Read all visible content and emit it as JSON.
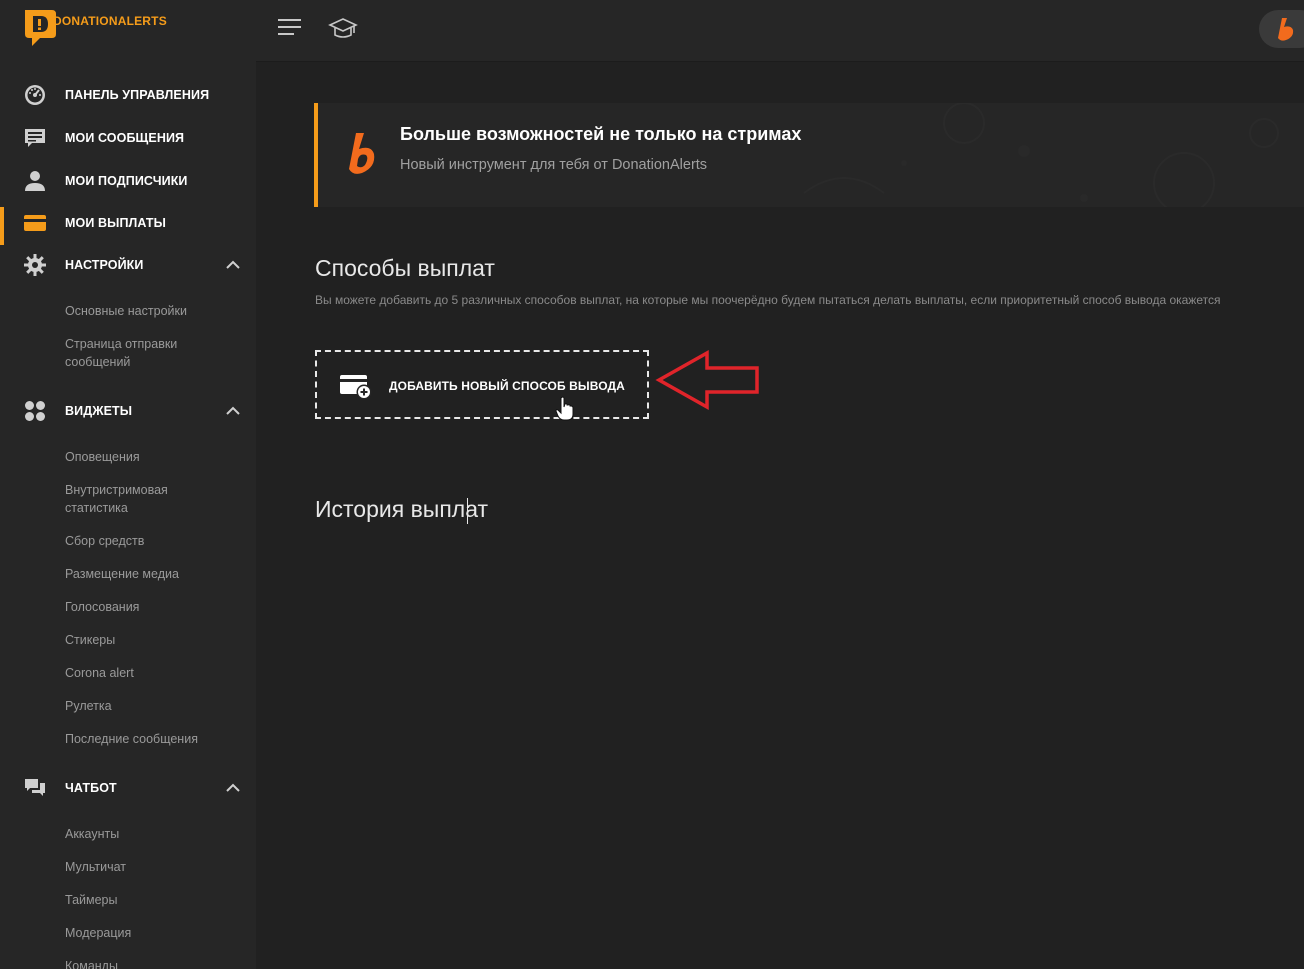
{
  "app": {
    "name": "DONATIONALERTS"
  },
  "sidebar": {
    "items": [
      {
        "label": "ПАНЕЛЬ УПРАВЛЕНИЯ",
        "icon": "dashboard-gauge-icon"
      },
      {
        "label": "МОИ СООБЩЕНИЯ",
        "icon": "message-icon"
      },
      {
        "label": "МОИ ПОДПИСЧИКИ",
        "icon": "user-icon"
      },
      {
        "label": "МОИ ВЫПЛАТЫ",
        "icon": "payment-card-icon",
        "active": true
      },
      {
        "label": "НАСТРОЙКИ",
        "icon": "gear-icon",
        "expanded": true
      },
      {
        "label": "ВИДЖЕТЫ",
        "icon": "widgets-icon",
        "expanded": true
      },
      {
        "label": "ЧАТБОТ",
        "icon": "chat-icon",
        "expanded": true
      }
    ],
    "settings_sub": [
      "Основные настройки",
      "Страница отправки сообщений"
    ],
    "widgets_sub": [
      "Оповещения",
      "Внутристримовая статистика",
      "Сбор средств",
      "Размещение медиа",
      "Голосования",
      "Стикеры",
      "Corona alert",
      "Рулетка",
      "Последние сообщения"
    ],
    "chatbot_sub": [
      "Аккаунты",
      "Мультичат",
      "Таймеры",
      "Модерация",
      "Команды"
    ]
  },
  "topbar": {
    "icons": [
      "menu-icon",
      "graduation-cap-icon",
      "profile-avatar"
    ]
  },
  "banner": {
    "title": "Больше возможностей не только на стримах",
    "subtitle": "Новый инструмент для тебя от DonationAlerts"
  },
  "payouts": {
    "title": "Способы выплат",
    "description": "Вы можете добавить до 5 различных способов выплат, на которые мы поочерёдно будем пытаться делать выплаты, если приоритетный способ вывода окажется",
    "add_button": "ДОБАВИТЬ НОВЫЙ СПОСОБ ВЫВОДА"
  },
  "history": {
    "title": "История выплат"
  },
  "colors": {
    "accent": "#f59c1a",
    "background": "#212121",
    "sidebar": "#262626",
    "annotation_arrow": "#e0242a"
  }
}
